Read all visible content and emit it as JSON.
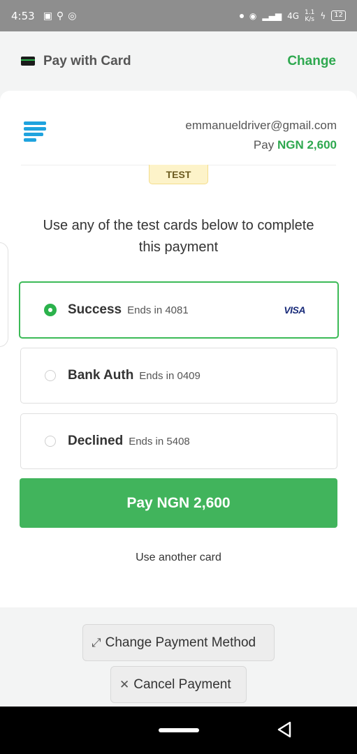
{
  "status_bar": {
    "time": "4:53",
    "network": "4G",
    "speed_top": "1.1",
    "speed_unit": "K/s",
    "battery": "12"
  },
  "header": {
    "title": "Pay with Card",
    "change_label": "Change"
  },
  "merchant": {
    "email": "emmanueldriver@gmail.com",
    "pay_prefix": "Pay",
    "amount": "NGN 2,600"
  },
  "badge": "TEST",
  "instruction": "Use any of the test cards below to complete this payment",
  "cards": [
    {
      "name": "Success",
      "ends": "Ends in 4081",
      "brand": "VISA",
      "selected": true
    },
    {
      "name": "Bank Auth",
      "ends": "Ends in 0409",
      "brand": "",
      "selected": false
    },
    {
      "name": "Declined",
      "ends": "Ends in 5408",
      "brand": "",
      "selected": false
    }
  ],
  "pay_button": "Pay NGN 2,600",
  "use_another": "Use another card",
  "change_method": "Change Payment Method",
  "cancel_payment": "Cancel Payment",
  "colors": {
    "accent_green": "#41b45c",
    "brand_blue": "#1fa3de",
    "status_bar": "#8e8e8e"
  }
}
